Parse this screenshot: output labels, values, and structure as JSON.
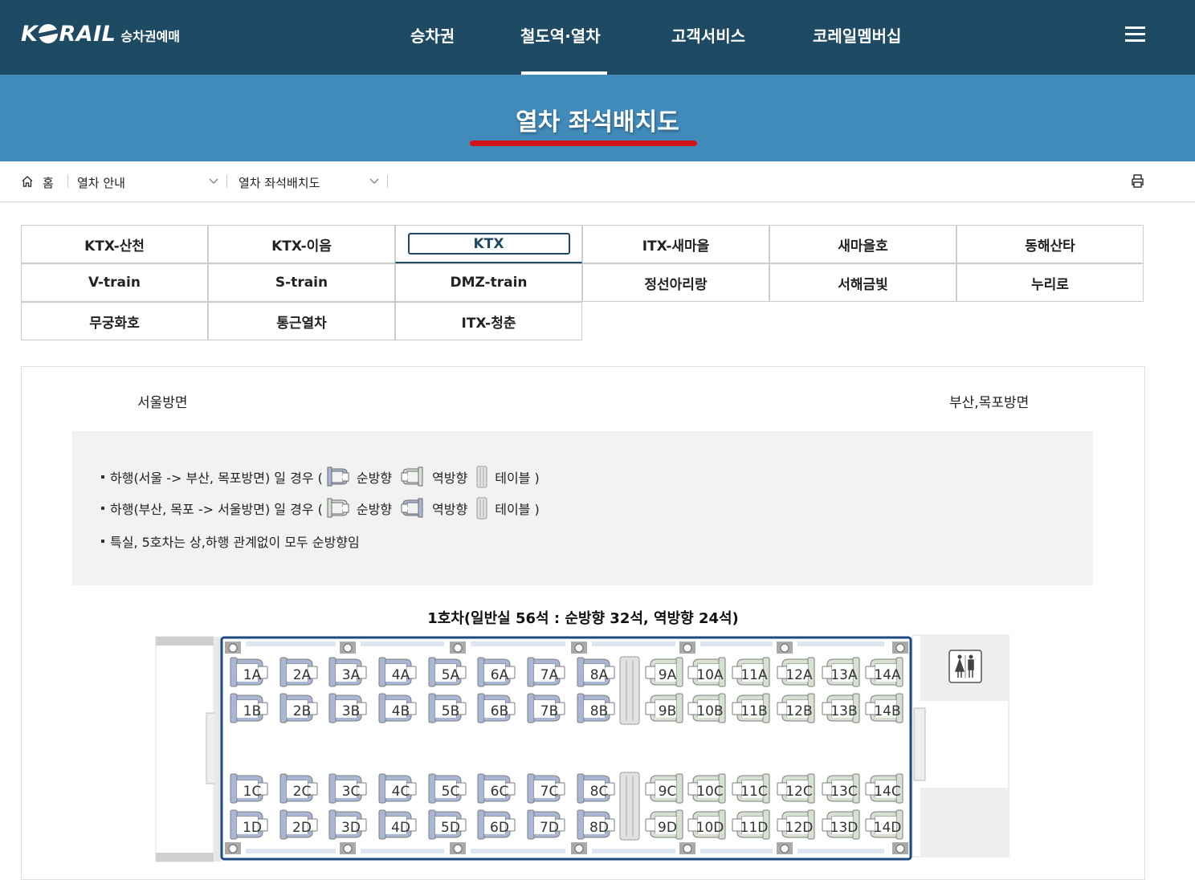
{
  "header": {
    "logo_text": "KORAIL",
    "logo_sub": "승차권예매",
    "nav": [
      "승차권",
      "철도역·열차",
      "고객서비스",
      "코레일멤버십"
    ],
    "active_nav": "철도역·열차"
  },
  "banner": {
    "title": "열차 좌석배치도"
  },
  "breadcrumb": {
    "home": "홈",
    "level1": "열차 안내",
    "level2": "열차 좌석배치도"
  },
  "train_tabs": [
    [
      "KTX-산천",
      "KTX-이음",
      "KTX",
      "ITX-새마을",
      "새마을호",
      "동해산타"
    ],
    [
      "V-train",
      "S-train",
      "DMZ-train",
      "정선아리랑",
      "서해금빛",
      "누리로"
    ],
    [
      "무궁화호",
      "통근열차",
      "ITX-청춘"
    ]
  ],
  "active_tab": "KTX",
  "directions": {
    "left": "서울방면",
    "right": "부산,목포방면"
  },
  "legend": {
    "row1": {
      "prefix": "하행(서울 -> 부산, 목포방면) 일 경우 (",
      "forward": "순방향",
      "reverse": "역방향",
      "table": "테이블 )"
    },
    "row2": {
      "prefix": "하행(부산, 목포 -> 서울방면) 일 경우 (",
      "forward": "순방향",
      "reverse": "역방향",
      "table": "테이블 )"
    },
    "row3": "특실, 5호차는 상,하행 관계없이 모두 순방향임"
  },
  "car": {
    "title": "1호차(일반실 56석 : 순방향 32석, 역방향 24석)",
    "rows": [
      "A",
      "B",
      "C",
      "D"
    ],
    "forward_seat_numbers": [
      1,
      2,
      3,
      4,
      5,
      6,
      7,
      8
    ],
    "reverse_seat_numbers": [
      9,
      10,
      11,
      12,
      13,
      14
    ],
    "colors": {
      "forward": "#a9b6d4",
      "reverse": "#d6e1d4",
      "frame": "#1e4a80",
      "seat_stroke": "#7d7d7d"
    }
  },
  "icons": [
    "home-icon",
    "chevron-down-icon",
    "print-icon",
    "hamburger-icon",
    "restroom-icon"
  ]
}
